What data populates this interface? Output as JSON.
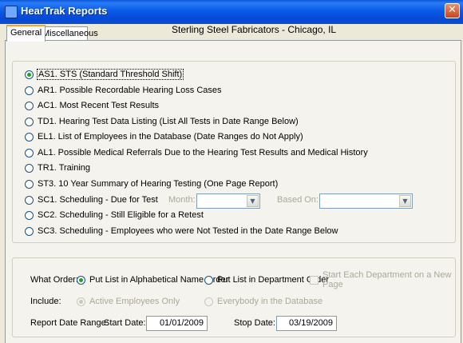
{
  "window": {
    "title": "HearTrak Reports",
    "close_glyph": "✕"
  },
  "tabs": [
    {
      "label": "General",
      "active": true
    },
    {
      "label": "Miscellaneous",
      "active": false
    }
  ],
  "company": "Sterling Steel Fabricators - Chicago, IL",
  "reports": [
    {
      "label": "AS1. STS (Standard Threshold Shift)",
      "checked": true
    },
    {
      "label": "AR1. Possible Recordable Hearing Loss Cases",
      "checked": false
    },
    {
      "label": "AC1. Most Recent Test Results",
      "checked": false
    },
    {
      "label": "TD1. Hearing Test Data Listing (List All Tests in Date Range Below)",
      "checked": false
    },
    {
      "label": "EL1. List of Employees in the Database (Date Ranges do Not Apply)",
      "checked": false
    },
    {
      "label": "AL1. Possible Medical Referrals Due to the Hearing Test Results and Medical History",
      "checked": false
    },
    {
      "label": "TR1. Training",
      "checked": false
    },
    {
      "label": "ST3. 10 Year Summary of Hearing Testing (One Page Report)",
      "checked": false
    },
    {
      "label": "SC1. Scheduling - Due for Test",
      "checked": false
    },
    {
      "label": "SC2. Scheduling - Still Eligible for a Retest",
      "checked": false
    },
    {
      "label": "SC3. Scheduling - Employees who were Not Tested in the Date Range Below",
      "checked": false
    }
  ],
  "scheduling": {
    "month_label": "Month:",
    "month_value": "",
    "based_on_label": "Based On:",
    "based_on_value": ""
  },
  "order": {
    "label": "What Order:",
    "alphabetical": "Put List in Alphabetical Name Order",
    "department": "Put List in Department Order",
    "new_page": "Start Each Department on a New Page"
  },
  "include": {
    "label": "Include:",
    "active": "Active Employees Only",
    "everybody": "Everybody in the Database"
  },
  "date_range": {
    "label": "Report Date Range:",
    "start_label": "Start Date:",
    "start_value": "01/01/2009",
    "stop_label": "Stop Date:",
    "stop_value": "03/19/2009"
  },
  "colors": {
    "titlebar": "#0a56d8",
    "radio_dot": "#21a121",
    "tab_highlight": "#f1a33c"
  }
}
